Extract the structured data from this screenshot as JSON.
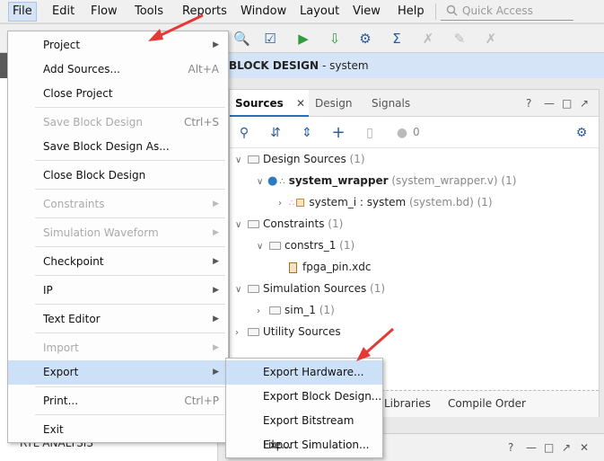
{
  "menubar": {
    "items": [
      "File",
      "Edit",
      "Flow",
      "Tools",
      "Reports",
      "Window",
      "Layout",
      "View",
      "Help"
    ],
    "quick_access_placeholder": "Quick Access"
  },
  "block_design": {
    "prefix": "BLOCK DESIGN",
    "name": "- system"
  },
  "left_panel": {
    "bottom_label": "RTL ANALYSIS"
  },
  "sources_panel": {
    "tabs": [
      "Sources",
      "Design",
      "Signals"
    ],
    "count_badge": "0",
    "tree": {
      "design_sources": {
        "label": "Design Sources",
        "count": "(1)"
      },
      "system_wrapper": {
        "label": "system_wrapper",
        "detail": "(system_wrapper.v)",
        "count": "(1)"
      },
      "system_i": {
        "label": "system_i : system",
        "detail": "(system.bd)",
        "count": "(1)"
      },
      "constraints": {
        "label": "Constraints",
        "count": "(1)"
      },
      "constrs_1": {
        "label": "constrs_1",
        "count": "(1)"
      },
      "fpga_pin": {
        "label": "fpga_pin.xdc"
      },
      "simulation_sources": {
        "label": "Simulation Sources",
        "count": "(1)"
      },
      "sim_1": {
        "label": "sim_1",
        "count": "(1)"
      },
      "utility_sources": {
        "label": "Utility Sources"
      }
    },
    "bottom_tabs": [
      "Libraries",
      "Compile Order"
    ]
  },
  "file_menu": {
    "items": [
      {
        "label": "Project",
        "shortcut": "",
        "submenu": true,
        "disabled": false
      },
      {
        "label": "Add Sources...",
        "shortcut": "Alt+A",
        "submenu": false,
        "disabled": false
      },
      {
        "label": "Close Project",
        "shortcut": "",
        "submenu": false,
        "disabled": false
      },
      {
        "label": "Save Block Design",
        "shortcut": "Ctrl+S",
        "submenu": false,
        "disabled": true
      },
      {
        "label": "Save Block Design As...",
        "shortcut": "",
        "submenu": false,
        "disabled": false
      },
      {
        "label": "Close Block Design",
        "shortcut": "",
        "submenu": false,
        "disabled": false
      },
      {
        "label": "Constraints",
        "shortcut": "",
        "submenu": true,
        "disabled": true
      },
      {
        "label": "Simulation Waveform",
        "shortcut": "",
        "submenu": true,
        "disabled": true
      },
      {
        "label": "Checkpoint",
        "shortcut": "",
        "submenu": true,
        "disabled": false
      },
      {
        "label": "IP",
        "shortcut": "",
        "submenu": true,
        "disabled": false
      },
      {
        "label": "Text Editor",
        "shortcut": "",
        "submenu": true,
        "disabled": false
      },
      {
        "label": "Import",
        "shortcut": "",
        "submenu": true,
        "disabled": true
      },
      {
        "label": "Export",
        "shortcut": "",
        "submenu": true,
        "disabled": false
      },
      {
        "label": "Print...",
        "shortcut": "Ctrl+P",
        "submenu": false,
        "disabled": false
      },
      {
        "label": "Exit",
        "shortcut": "",
        "submenu": false,
        "disabled": false
      }
    ]
  },
  "export_submenu": {
    "items": [
      "Export Hardware...",
      "Export Block Design...",
      "Export Bitstream File...",
      "Export Simulation..."
    ]
  },
  "colors": {
    "highlight": "#cce0f7",
    "header_bg": "#d5e5f7",
    "annotation_arrow": "#e53935"
  }
}
